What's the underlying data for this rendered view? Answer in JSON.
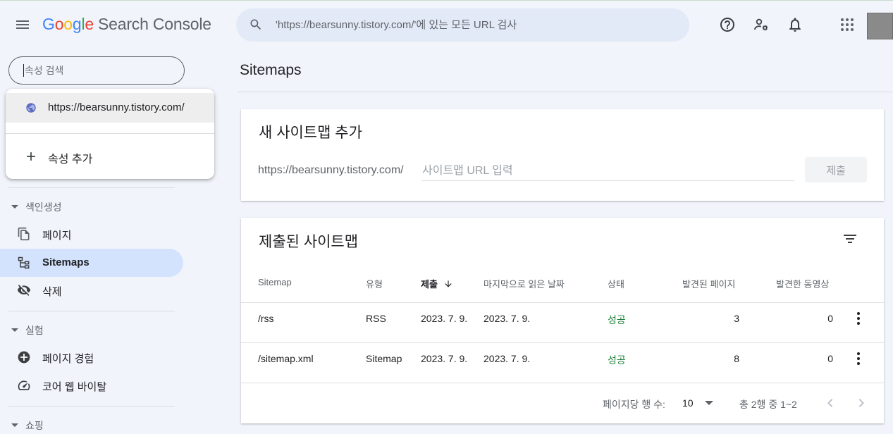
{
  "header": {
    "logo_google": [
      "G",
      "o",
      "o",
      "g",
      "l",
      "e"
    ],
    "logo_product": "Search Console",
    "search_placeholder": "'https://bearsunny.tistory.com/'에 있는 모든 URL 검사",
    "icons": [
      "help-icon",
      "manage-users-icon",
      "notifications-icon",
      "apps-grid-icon"
    ]
  },
  "sidebar": {
    "property_search_placeholder": "속성 검색",
    "dropdown": {
      "property": "https://bearsunny.tistory.com/",
      "add_property": "속성 추가"
    },
    "sections": [
      {
        "title": "색인생성",
        "items": [
          {
            "label": "페이지",
            "icon": "pages-icon"
          },
          {
            "label": "Sitemaps",
            "icon": "sitemap-icon",
            "active": true
          },
          {
            "label": "삭제",
            "icon": "removals-icon"
          }
        ]
      },
      {
        "title": "실험",
        "items": [
          {
            "label": "페이지 경험",
            "icon": "page-experience-icon"
          },
          {
            "label": "코어 웹 바이탈",
            "icon": "core-web-vitals-icon"
          }
        ]
      },
      {
        "title": "쇼핑",
        "items": []
      }
    ]
  },
  "main": {
    "page_title": "Sitemaps",
    "add_card": {
      "title": "새 사이트맵 추가",
      "url_prefix": "https://bearsunny.tistory.com/",
      "input_placeholder": "사이트맵 URL 입력",
      "submit_label": "제출"
    },
    "submitted_card": {
      "title": "제출된 사이트맵",
      "columns": [
        "Sitemap",
        "유형",
        "제출",
        "마지막으로 읽은 날짜",
        "상태",
        "발견된 페이지",
        "발견한 동영상"
      ],
      "sorted_column": "제출",
      "rows": [
        {
          "sitemap": "/rss",
          "type": "RSS",
          "submitted": "2023. 7. 9.",
          "last_read": "2023. 7. 9.",
          "status": "성공",
          "pages": "3",
          "videos": "0"
        },
        {
          "sitemap": "/sitemap.xml",
          "type": "Sitemap",
          "submitted": "2023. 7. 9.",
          "last_read": "2023. 7. 9.",
          "status": "성공",
          "pages": "8",
          "videos": "0"
        }
      ],
      "footer": {
        "rows_per_page_label": "페이지당 행 수:",
        "rows_per_page_value": "10",
        "range_text": "총 2행 중 1~2"
      }
    }
  },
  "colors": {
    "background": "#f1f4fb",
    "active_nav": "#d3e3fd",
    "status_success": "#188038"
  }
}
